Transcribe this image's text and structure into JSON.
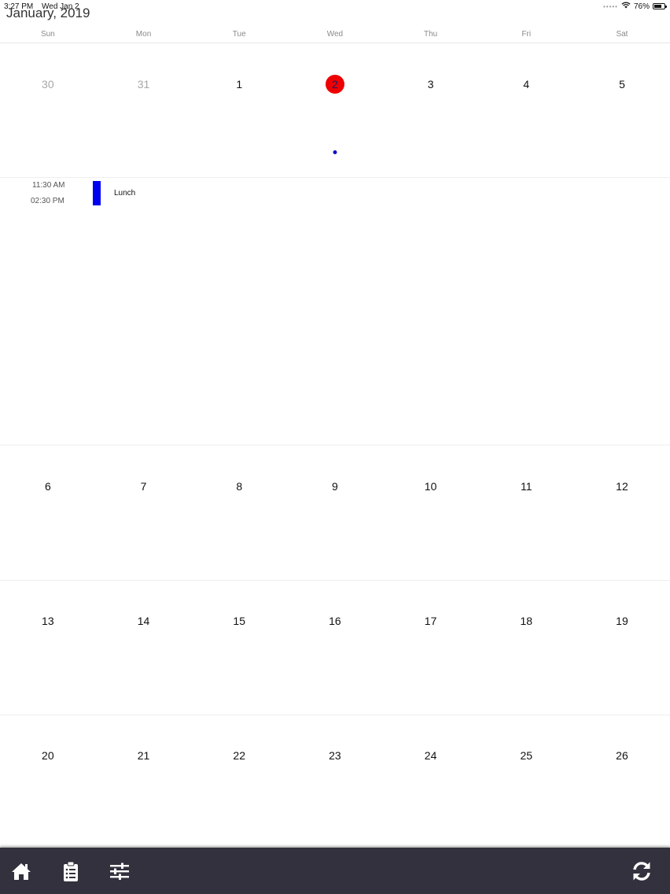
{
  "status_bar": {
    "time": "3:27 PM",
    "date": "Wed Jan 2",
    "battery": "76%",
    "battery_level": 0.76
  },
  "calendar": {
    "month_title": "January, 2019",
    "weekdays": [
      "Sun",
      "Mon",
      "Tue",
      "Wed",
      "Thu",
      "Fri",
      "Sat"
    ],
    "weeks": [
      [
        {
          "d": "30",
          "muted": true
        },
        {
          "d": "31",
          "muted": true
        },
        {
          "d": "1"
        },
        {
          "d": "2",
          "today": true,
          "event": true
        },
        {
          "d": "3"
        },
        {
          "d": "4"
        },
        {
          "d": "5"
        }
      ],
      [
        {
          "d": "6"
        },
        {
          "d": "7"
        },
        {
          "d": "8"
        },
        {
          "d": "9"
        },
        {
          "d": "10"
        },
        {
          "d": "11"
        },
        {
          "d": "12"
        }
      ],
      [
        {
          "d": "13"
        },
        {
          "d": "14"
        },
        {
          "d": "15"
        },
        {
          "d": "16"
        },
        {
          "d": "17"
        },
        {
          "d": "18"
        },
        {
          "d": "19"
        }
      ],
      [
        {
          "d": "20"
        },
        {
          "d": "21"
        },
        {
          "d": "22"
        },
        {
          "d": "23"
        },
        {
          "d": "24"
        },
        {
          "d": "25"
        },
        {
          "d": "26"
        }
      ]
    ]
  },
  "selected_day_events": [
    {
      "start": "11:30 AM",
      "end": "02:30 PM",
      "title": "Lunch",
      "color": "#0000ee"
    }
  ],
  "toolbar": {
    "background": "#32313d",
    "left_icons": [
      "home-icon",
      "clipboard-icon",
      "sliders-icon"
    ],
    "right_icons": [
      "refresh-icon"
    ]
  },
  "colors": {
    "today_highlight": "#ee0000",
    "event_dot": "#1010c0"
  }
}
